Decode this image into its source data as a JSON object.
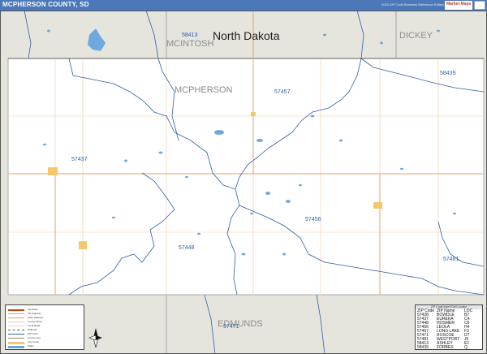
{
  "header": {
    "title": "MCPHERSON COUNTY, SD",
    "edition": "2025 ZIP Code Business Reference Edition",
    "brand": "Market Maps"
  },
  "map": {
    "state_label": "North Dakota",
    "county_labels": {
      "mcintosh": "MCINTOSH",
      "dickey": "DICKEY",
      "mcpherson": "MCPHERSON",
      "edmunds": "EDMUNDS"
    },
    "zip_labels": [
      "58413",
      "57457",
      "58439",
      "57437",
      "57456",
      "57448",
      "57481",
      "57471"
    ],
    "colors": {
      "outside_fill": "#e5e5de",
      "county_fill": "#ffffff",
      "water": "#6fa8dc",
      "zip_boundary": "#2f5ea8",
      "road": "#e8b07c",
      "town": "#f4c86a"
    }
  },
  "legend": {
    "items": [
      "Interstate",
      "US Highway",
      "State Highway",
      "County Road",
      "Local Road",
      "Railroad",
      "ZIP Code",
      "County Line",
      "City Limits",
      "Water"
    ]
  },
  "zip_table": {
    "title": "ZIP Code Index/Grid Locator",
    "headers": [
      "ZIP Code",
      "ZIP Name",
      "LOC"
    ],
    "rows": [
      [
        "57428",
        "BOWDLE",
        "B7"
      ],
      [
        "57437",
        "EUREKA",
        "C4"
      ],
      [
        "57448",
        "HOSMER",
        "C6"
      ],
      [
        "57456",
        "LEOLA",
        "H4"
      ],
      [
        "57457",
        "LONG LAKE",
        "F3"
      ],
      [
        "57471",
        "ROSCOE",
        "D7"
      ],
      [
        "57481",
        "WESTPORT",
        "J5"
      ],
      [
        "58413",
        "ASHLEY",
        "E1"
      ],
      [
        "58439",
        "FORBES",
        "Q"
      ]
    ]
  }
}
